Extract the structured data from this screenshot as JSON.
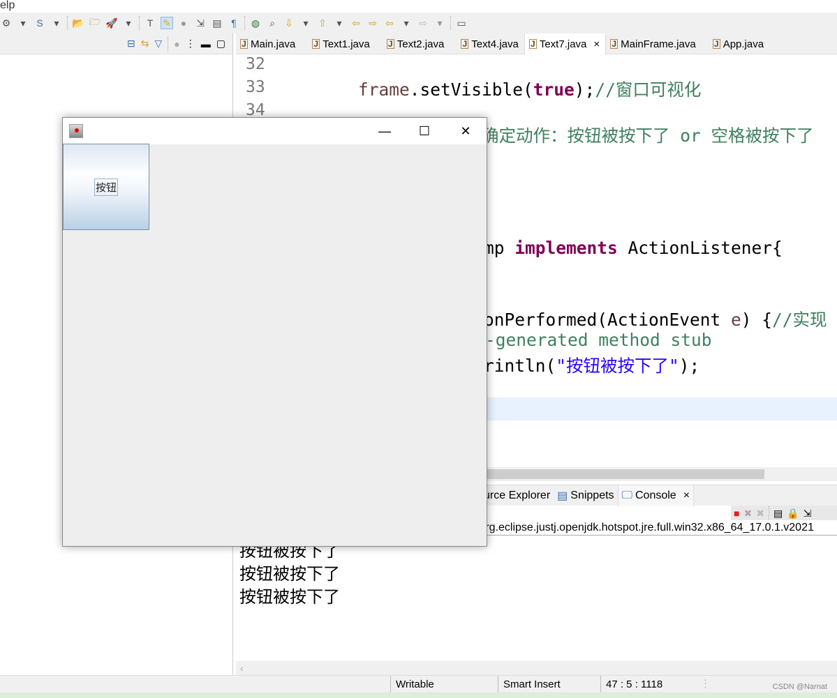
{
  "menubar": {
    "partial_item": "elp"
  },
  "editor": {
    "tabs": [
      {
        "label": "Main.java"
      },
      {
        "label": "Text1.java"
      },
      {
        "label": "Text2.java"
      },
      {
        "label": "Text4.java"
      },
      {
        "label": "Text7.java",
        "active": true,
        "close": "×"
      },
      {
        "label": "MainFrame.java"
      },
      {
        "label": "App.java"
      }
    ],
    "line_numbers": [
      "32",
      "33",
      "34"
    ],
    "line33": {
      "field": "frame",
      "mid": ".setVisible(",
      "kw": "true",
      "end": ");",
      "comment": "//窗口可视化"
    },
    "line35_comment": "确定动作：按钮被按下了 or 空格被按下了",
    "line40": {
      "pre": "mp ",
      "kw": "implements",
      "post": " ActionListener{"
    },
    "line43": {
      "pre": "onPerformed(ActionEvent ",
      "param": "e",
      "post": ") {",
      "comment": "//实现"
    },
    "line44_comment": "-generated method stub",
    "line45": {
      "pre": "rintln(",
      "str": "\"按钮被按下了\"",
      "post": ");"
    }
  },
  "bottom_tabs": [
    {
      "label": "urce Explorer"
    },
    {
      "label": "Snippets"
    },
    {
      "label": "Console",
      "active": true,
      "close": "×"
    }
  ],
  "console": {
    "path": "s\\org.eclipse.justj.openjdk.hotspot.jre.full.win32.x86_64_17.0.1.v2021",
    "output": [
      "按钮被按下了",
      "按钮被按下了",
      "按钮被按下了"
    ]
  },
  "statusbar": {
    "writable": "Writable",
    "insert_mode": "Smart Insert",
    "position": "47 : 5 : 1118",
    "watermark": "CSDN @Narnat"
  },
  "java_window": {
    "button_label": "按钮",
    "minimize": "—",
    "maximize": "☐",
    "close": "✕"
  },
  "colors": {
    "keyword": "#7f0055",
    "comment": "#3f7f5f",
    "string": "#2a00ff",
    "current_line": "#e8f2fe"
  }
}
